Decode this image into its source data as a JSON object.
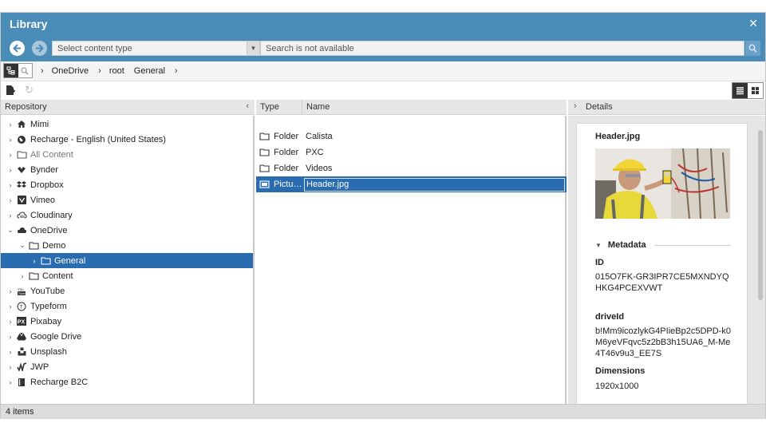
{
  "dialog": {
    "title": "Library",
    "close_glyph": "✕"
  },
  "toolbar": {
    "back_icon": "arrow-left-icon",
    "forward_icon": "arrow-right-icon",
    "content_type_placeholder": "Select content type",
    "search_placeholder": "Search is not available"
  },
  "breadcrumb": {
    "items": [
      "OneDrive",
      "root",
      "General"
    ]
  },
  "left_panel": {
    "header": "Repository",
    "tree": [
      {
        "label": "Mimi",
        "icon": "home-icon",
        "expanded": false,
        "level": 0
      },
      {
        "label": "Recharge - English (United States)",
        "icon": "globe-icon",
        "expanded": false,
        "level": 0
      },
      {
        "label": "All Content",
        "icon": "folder-icon",
        "expanded": false,
        "level": 0
      },
      {
        "label": "Bynder",
        "icon": "bynder-icon",
        "expanded": false,
        "level": 0
      },
      {
        "label": "Dropbox",
        "icon": "dropbox-icon",
        "expanded": false,
        "level": 0
      },
      {
        "label": "Vimeo",
        "icon": "vimeo-icon",
        "expanded": false,
        "level": 0
      },
      {
        "label": "Cloudinary",
        "icon": "cloud-outline-icon",
        "expanded": false,
        "level": 0
      },
      {
        "label": "OneDrive",
        "icon": "cloud-icon",
        "expanded": true,
        "level": 0
      },
      {
        "label": "Demo",
        "icon": "folder-icon",
        "expanded": true,
        "level": 1
      },
      {
        "label": "General",
        "icon": "folder-icon",
        "expanded": false,
        "level": 2
      },
      {
        "label": "Content",
        "icon": "folder-icon",
        "expanded": false,
        "level": 1
      },
      {
        "label": "YouTube",
        "icon": "youtube-icon",
        "expanded": false,
        "level": 0
      },
      {
        "label": "Typeform",
        "icon": "typeform-icon",
        "expanded": false,
        "level": 0
      },
      {
        "label": "Pixabay",
        "icon": "pixabay-icon",
        "expanded": false,
        "level": 0
      },
      {
        "label": "Google Drive",
        "icon": "google-drive-icon",
        "expanded": false,
        "level": 0
      },
      {
        "label": "Unsplash",
        "icon": "unsplash-icon",
        "expanded": false,
        "level": 0
      },
      {
        "label": "JWP",
        "icon": "jwp-icon",
        "expanded": false,
        "level": 0
      },
      {
        "label": "Recharge B2C",
        "icon": "book-icon",
        "expanded": false,
        "level": 0
      }
    ]
  },
  "middle_panel": {
    "col_type": "Type",
    "col_name": "Name",
    "rows": [
      {
        "type": "Folder",
        "name": "Calista"
      },
      {
        "type": "Folder",
        "name": "PXC"
      },
      {
        "type": "Folder",
        "name": "Videos"
      },
      {
        "type": "Pictu…",
        "name": "Header.jpg"
      }
    ]
  },
  "right_panel": {
    "header": "Details",
    "file_name": "Header.jpg",
    "metadata_title": "Metadata",
    "fields": [
      {
        "label": "ID",
        "value": "015O7FK-GR3IPR7CE5MXNDYQHKG4PCEXVWT"
      },
      {
        "label": "driveId",
        "value": "b!Mm9icozlykG4PIieBp2c5DPD-k0M6yeVFqvc5z2bB3h15UA6_M-Me4T46v9u3_EE7S"
      },
      {
        "label": "Dimensions",
        "value": "1920x1000"
      }
    ]
  },
  "status": {
    "text": "4 items"
  },
  "colors": {
    "accent": "#4a8cb8",
    "selection": "#2a6cb0"
  }
}
